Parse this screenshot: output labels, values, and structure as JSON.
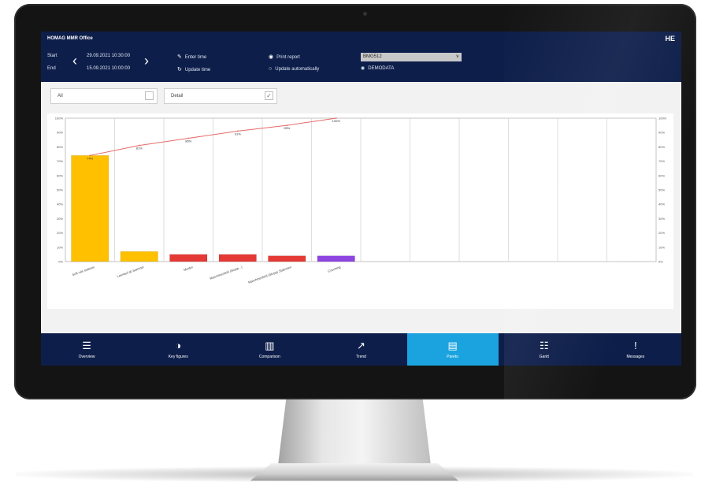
{
  "app": {
    "title": "HOMAG MMR Office",
    "logo": "HE"
  },
  "header": {
    "start_label": "Start",
    "end_label": "End",
    "start_date": "29.09.2021 10:30:00",
    "end_date": "15.09.2021 10:00:00",
    "enter_time": "Enter time",
    "update_time": "Update time",
    "print_report": "Print report",
    "update_automatically": "Update automatically",
    "machine": "BMG512",
    "data_source": "DEMODATA"
  },
  "filters": {
    "scope": "All",
    "view": "Detail"
  },
  "chart_data": {
    "type": "bar",
    "categories": [
      "Soft rule stations",
      "Leerlauf ab Sammel",
      "Muster",
      "Maschinenfehl (Stopp...)",
      "Maschinenfehl (Stopp) Stationen",
      "Couching"
    ],
    "values": [
      74,
      7,
      5,
      5,
      4,
      4
    ],
    "cumulative_percent": [
      74,
      81,
      86,
      91,
      95,
      100
    ],
    "bar_labels": [
      "74%",
      "81%",
      "86%",
      "91%",
      "95%",
      "100%"
    ],
    "bar_colors": [
      "#ffc000",
      "#ffc000",
      "#e53935",
      "#e53935",
      "#e53935",
      "#8e44e0"
    ],
    "line_color": "#e56a6a",
    "ylim": [
      0,
      100
    ],
    "yticks": [
      "0%",
      "10%",
      "20%",
      "30%",
      "40%",
      "50%",
      "60%",
      "70%",
      "80%",
      "90%",
      "100%"
    ],
    "column_slots": 12,
    "grid": true
  },
  "nav": [
    {
      "label": "Overview",
      "icon": "list-icon",
      "glyph": "☰",
      "active": false
    },
    {
      "label": "Key figures",
      "icon": "gauge-icon",
      "glyph": "◑",
      "active": false
    },
    {
      "label": "Comparison",
      "icon": "bar-chart-icon",
      "glyph": "▥",
      "active": false
    },
    {
      "label": "Trend",
      "icon": "trend-icon",
      "glyph": "↗",
      "active": false
    },
    {
      "label": "Pareto",
      "icon": "pareto-icon",
      "glyph": "▤",
      "active": true
    },
    {
      "label": "Gantt",
      "icon": "gantt-icon",
      "glyph": "☷",
      "active": false
    },
    {
      "label": "Messages",
      "icon": "alert-icon",
      "glyph": "!",
      "active": false
    }
  ],
  "colors": {
    "header_bg": "#0d1e4a",
    "nav_active": "#1aa3de"
  }
}
